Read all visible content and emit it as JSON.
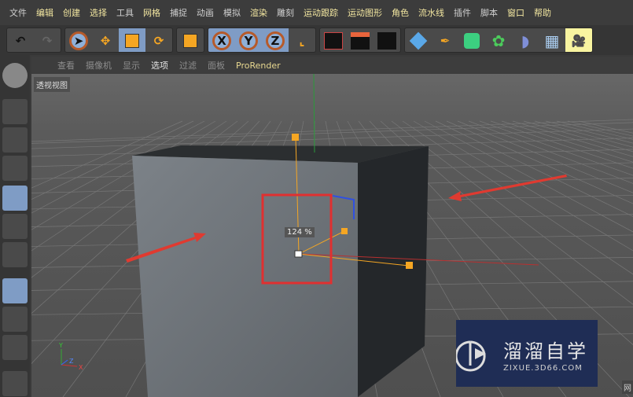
{
  "menu": [
    "文件",
    "编辑",
    "创建",
    "选择",
    "工具",
    "网格",
    "捕捉",
    "动画",
    "模拟",
    "渲染",
    "雕刻",
    "运动跟踪",
    "运动图形",
    "角色",
    "流水线",
    "插件",
    "脚本",
    "窗口",
    "帮助"
  ],
  "toolbar": {
    "axes": [
      "X",
      "Y",
      "Z"
    ]
  },
  "viewport_menu": [
    "查看",
    "摄像机",
    "显示",
    "选项",
    "过滤",
    "面板",
    "ProRender"
  ],
  "viewport": {
    "title": "透视视图",
    "scale_readout": "124 %",
    "corner_text": "网"
  },
  "axis_gizmo": [
    "Y",
    "Z",
    "X"
  ],
  "watermark": {
    "text": "溜溜自学",
    "url": "ZIXUE.3D66.COM"
  },
  "colors": {
    "highlight_box": "#e03030",
    "arrows": "#e03a30",
    "handle": "#f5a623"
  }
}
